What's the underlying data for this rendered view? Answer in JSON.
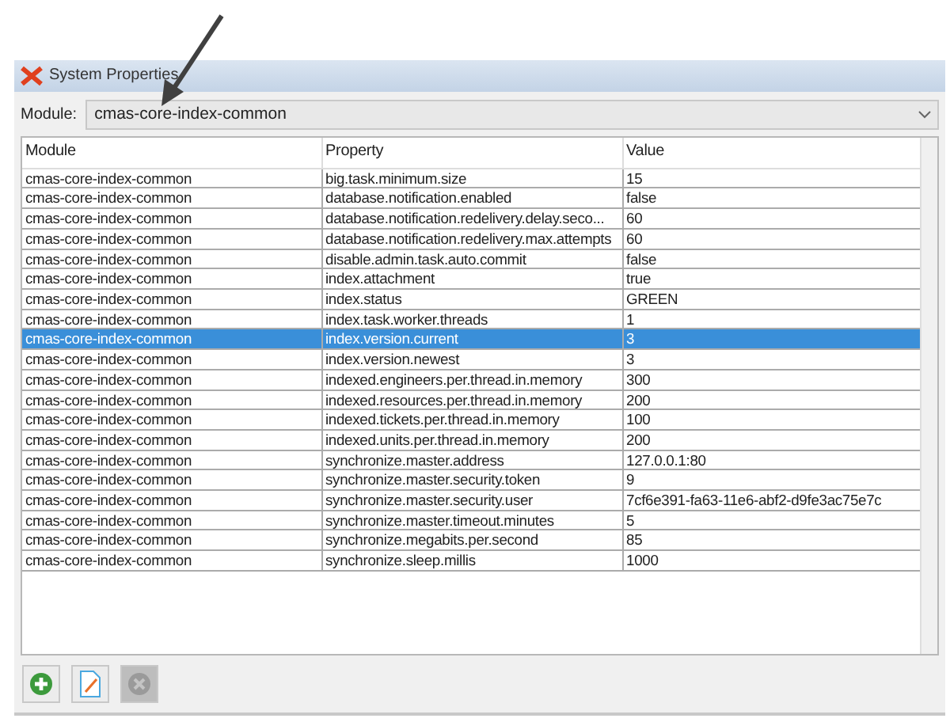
{
  "window": {
    "title": "System Properties"
  },
  "module_field": {
    "label": "Module:",
    "value": "cmas-core-index-common"
  },
  "table": {
    "columns": [
      "Module",
      "Property",
      "Value"
    ],
    "rows": [
      {
        "module": "cmas-core-index-common",
        "property": "big.task.minimum.size",
        "value": "15",
        "selected": false
      },
      {
        "module": "cmas-core-index-common",
        "property": "database.notification.enabled",
        "value": "false",
        "selected": false
      },
      {
        "module": "cmas-core-index-common",
        "property": "database.notification.redelivery.delay.seco...",
        "value": "60",
        "selected": false
      },
      {
        "module": "cmas-core-index-common",
        "property": "database.notification.redelivery.max.attempts",
        "value": "60",
        "selected": false
      },
      {
        "module": "cmas-core-index-common",
        "property": "disable.admin.task.auto.commit",
        "value": "false",
        "selected": false
      },
      {
        "module": "cmas-core-index-common",
        "property": "index.attachment",
        "value": "true",
        "selected": false
      },
      {
        "module": "cmas-core-index-common",
        "property": "index.status",
        "value": "GREEN",
        "selected": false
      },
      {
        "module": "cmas-core-index-common",
        "property": "index.task.worker.threads",
        "value": "1",
        "selected": false
      },
      {
        "module": "cmas-core-index-common",
        "property": "index.version.current",
        "value": "3",
        "selected": true
      },
      {
        "module": "cmas-core-index-common",
        "property": "index.version.newest",
        "value": "3",
        "selected": false
      },
      {
        "module": "cmas-core-index-common",
        "property": "indexed.engineers.per.thread.in.memory",
        "value": "300",
        "selected": false
      },
      {
        "module": "cmas-core-index-common",
        "property": "indexed.resources.per.thread.in.memory",
        "value": "200",
        "selected": false
      },
      {
        "module": "cmas-core-index-common",
        "property": "indexed.tickets.per.thread.in.memory",
        "value": "100",
        "selected": false
      },
      {
        "module": "cmas-core-index-common",
        "property": "indexed.units.per.thread.in.memory",
        "value": "200",
        "selected": false
      },
      {
        "module": "cmas-core-index-common",
        "property": "synchronize.master.address",
        "value": "127.0.0.1:80",
        "selected": false
      },
      {
        "module": "cmas-core-index-common",
        "property": "synchronize.master.security.token",
        "value": "9",
        "selected": false
      },
      {
        "module": "cmas-core-index-common",
        "property": "synchronize.master.security.user",
        "value": "7cf6e391-fa63-11e6-abf2-d9fe3ac75e7c",
        "selected": false
      },
      {
        "module": "cmas-core-index-common",
        "property": "synchronize.master.timeout.minutes",
        "value": "5",
        "selected": false
      },
      {
        "module": "cmas-core-index-common",
        "property": "synchronize.megabits.per.second",
        "value": "85",
        "selected": false
      },
      {
        "module": "cmas-core-index-common",
        "property": "synchronize.sleep.millis",
        "value": "1000",
        "selected": false
      }
    ]
  },
  "toolbar": [
    {
      "kind": "add",
      "disabled": false
    },
    {
      "kind": "edit",
      "disabled": false
    },
    {
      "kind": "delete",
      "disabled": true
    }
  ]
}
